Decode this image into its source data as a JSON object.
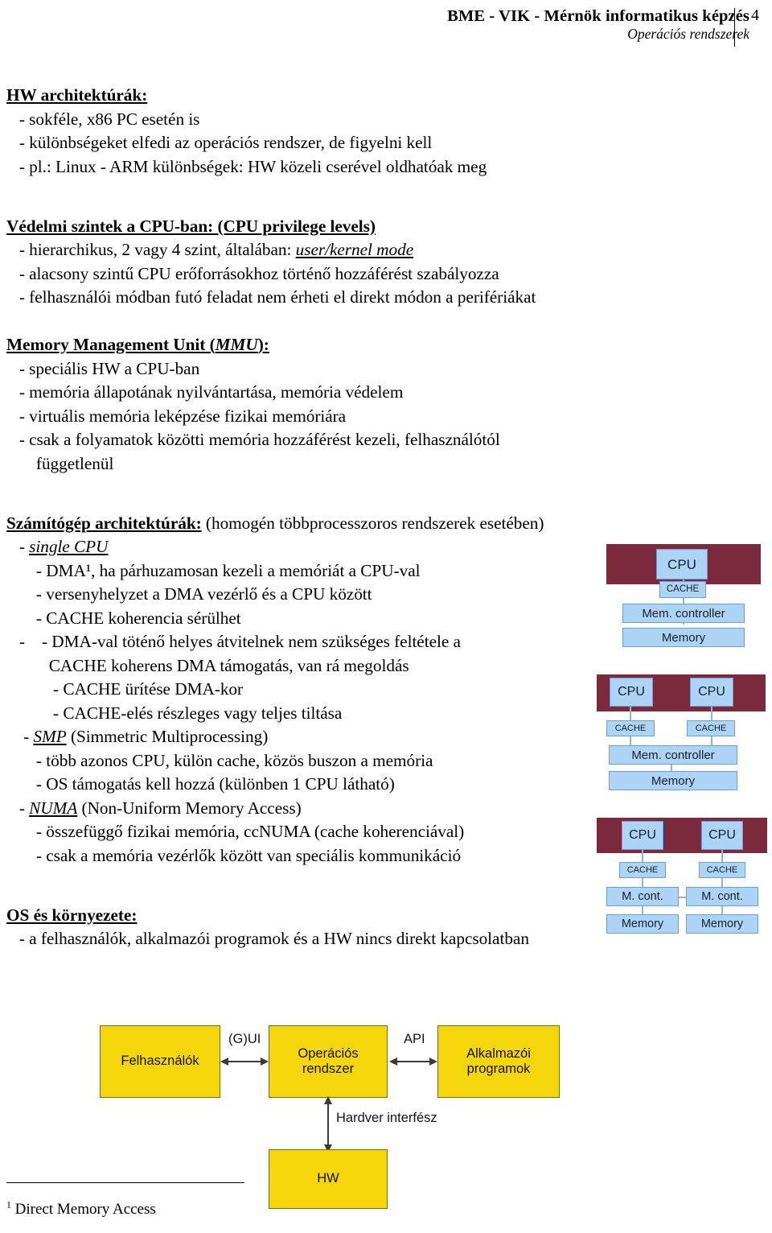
{
  "header": {
    "institution": "BME - VIK - Mérnök informatikus képzés",
    "course": "Operációs rendszerek",
    "page_number": "4"
  },
  "sections": {
    "hw_arch": {
      "title": "HW architektúrák:",
      "lines": [
        "   - sokféle, x86 PC esetén is",
        "   - különbségeket elfedi az operációs rendszer, de figyelni kell",
        "   - pl.: Linux - ARM különbségek: HW közeli cserével oldhatóak meg"
      ]
    },
    "privilege": {
      "title": "Védelmi szintek a CPU-ban: (CPU privilege levels)",
      "line1_pre": "   - hierarchikus, 2 vagy 4 szint, általában: ",
      "line1_italic": "user/kernel mode",
      "lines": [
        "   - alacsony szintű CPU erőforrásokhoz történő hozzáférést szabályozza",
        "   - felhasználói módban futó feladat nem érheti el direkt módon a perifériákat"
      ]
    },
    "mmu": {
      "title_pre": "Memory Management Unit (",
      "title_italic": "MMU",
      "title_post": "):",
      "lines": [
        "   - speciális HW a CPU-ban",
        "   - memória állapotának nyilvántartása, memória védelem",
        "   - virtuális memória leképzése fizikai memóriára",
        "   - csak a folyamatok közötti memória hozzáférést kezeli, felhasználótól",
        "       függetlenül"
      ]
    },
    "computer_arch": {
      "title": "Számítógép architektúrák:",
      "title_suffix": " (homogén többprocesszoros rendszerek esetében)",
      "items": [
        {
          "indent": "   - ",
          "italic": "single CPU",
          "text": ""
        },
        {
          "indent": "       - ",
          "italic": "",
          "text": "DMA¹, ha párhuzamosan kezeli a memóriát a CPU-val"
        },
        {
          "indent": "       - ",
          "italic": "",
          "text": "versenyhelyzet a DMA vezérlő és a CPU között"
        },
        {
          "indent": "       - ",
          "italic": "",
          "text": "CACHE koherencia sérülhet"
        },
        {
          "indent": "   -    - ",
          "italic": "",
          "text": "DMA-val töténő helyes átvitelnek nem szükséges feltétele a"
        },
        {
          "indent": "          ",
          "italic": "",
          "text": "CACHE koherens DMA támogatás, van rá megoldás"
        },
        {
          "indent": "           - ",
          "italic": "",
          "text": "CACHE ürítése DMA-kor"
        },
        {
          "indent": "           - ",
          "italic": "",
          "text": "CACHE-elés részleges vagy teljes tiltása"
        },
        {
          "indent": "    - ",
          "italic": "SMP",
          "text": " (Simmetric Multiprocessing)"
        },
        {
          "indent": "       - ",
          "italic": "",
          "text": "több azonos CPU, külön cache, közös buszon a memória"
        },
        {
          "indent": "       - ",
          "italic": "",
          "text": "OS támogatás kell hozzá (különben 1 CPU látható)"
        },
        {
          "indent": "   - ",
          "italic": "NUMA",
          "text": " (Non-Uniform Memory Access)"
        },
        {
          "indent": "       - ",
          "italic": "",
          "text": "összefüggő fizikai memória, ccNUMA (cache koherenciával)"
        },
        {
          "indent": "       - ",
          "italic": "",
          "text": "csak a memória vezérlők között van speciális kommunikáció"
        }
      ]
    },
    "os_env": {
      "title": "OS és környezete:",
      "lines": [
        "   - a felhasználók, alkalmazói programok és a HW nincs direkt kapcsolatban"
      ]
    }
  },
  "diagrams": {
    "colors": {
      "band": "#7a2a3c",
      "box_fill": "#aed4f5",
      "box_border": "#6a9fd8",
      "yellow_fill": "#f5d60a",
      "yellow_border": "#7c6a06"
    },
    "single_cpu": {
      "cpu": "CPU",
      "cache": "CACHE",
      "mem_controller": "Mem. controller",
      "memory": "Memory"
    },
    "smp": {
      "cpu_left": "CPU",
      "cpu_right": "CPU",
      "cache_left": "CACHE",
      "cache_right": "CACHE",
      "mem_controller": "Mem. controller",
      "memory": "Memory"
    },
    "numa": {
      "cpu_left": "CPU",
      "cpu_right": "CPU",
      "cache_left": "CACHE",
      "cache_right": "CACHE",
      "mcont_left": "M. cont.",
      "mcont_right": "M. cont.",
      "memory_left": "Memory",
      "memory_right": "Memory"
    },
    "os_environment": {
      "users": "Felhasználók",
      "os_line1": "Operációs",
      "os_line2": "rendszer",
      "apps_line1": "Alkalmazói",
      "apps_line2": "programok",
      "label_gui": "(G)UI",
      "label_api": "API",
      "label_hw_interface": "Hardver interfész",
      "hw": "HW"
    }
  },
  "footnote": {
    "marker": "1",
    "text": " Direct Memory Access"
  }
}
